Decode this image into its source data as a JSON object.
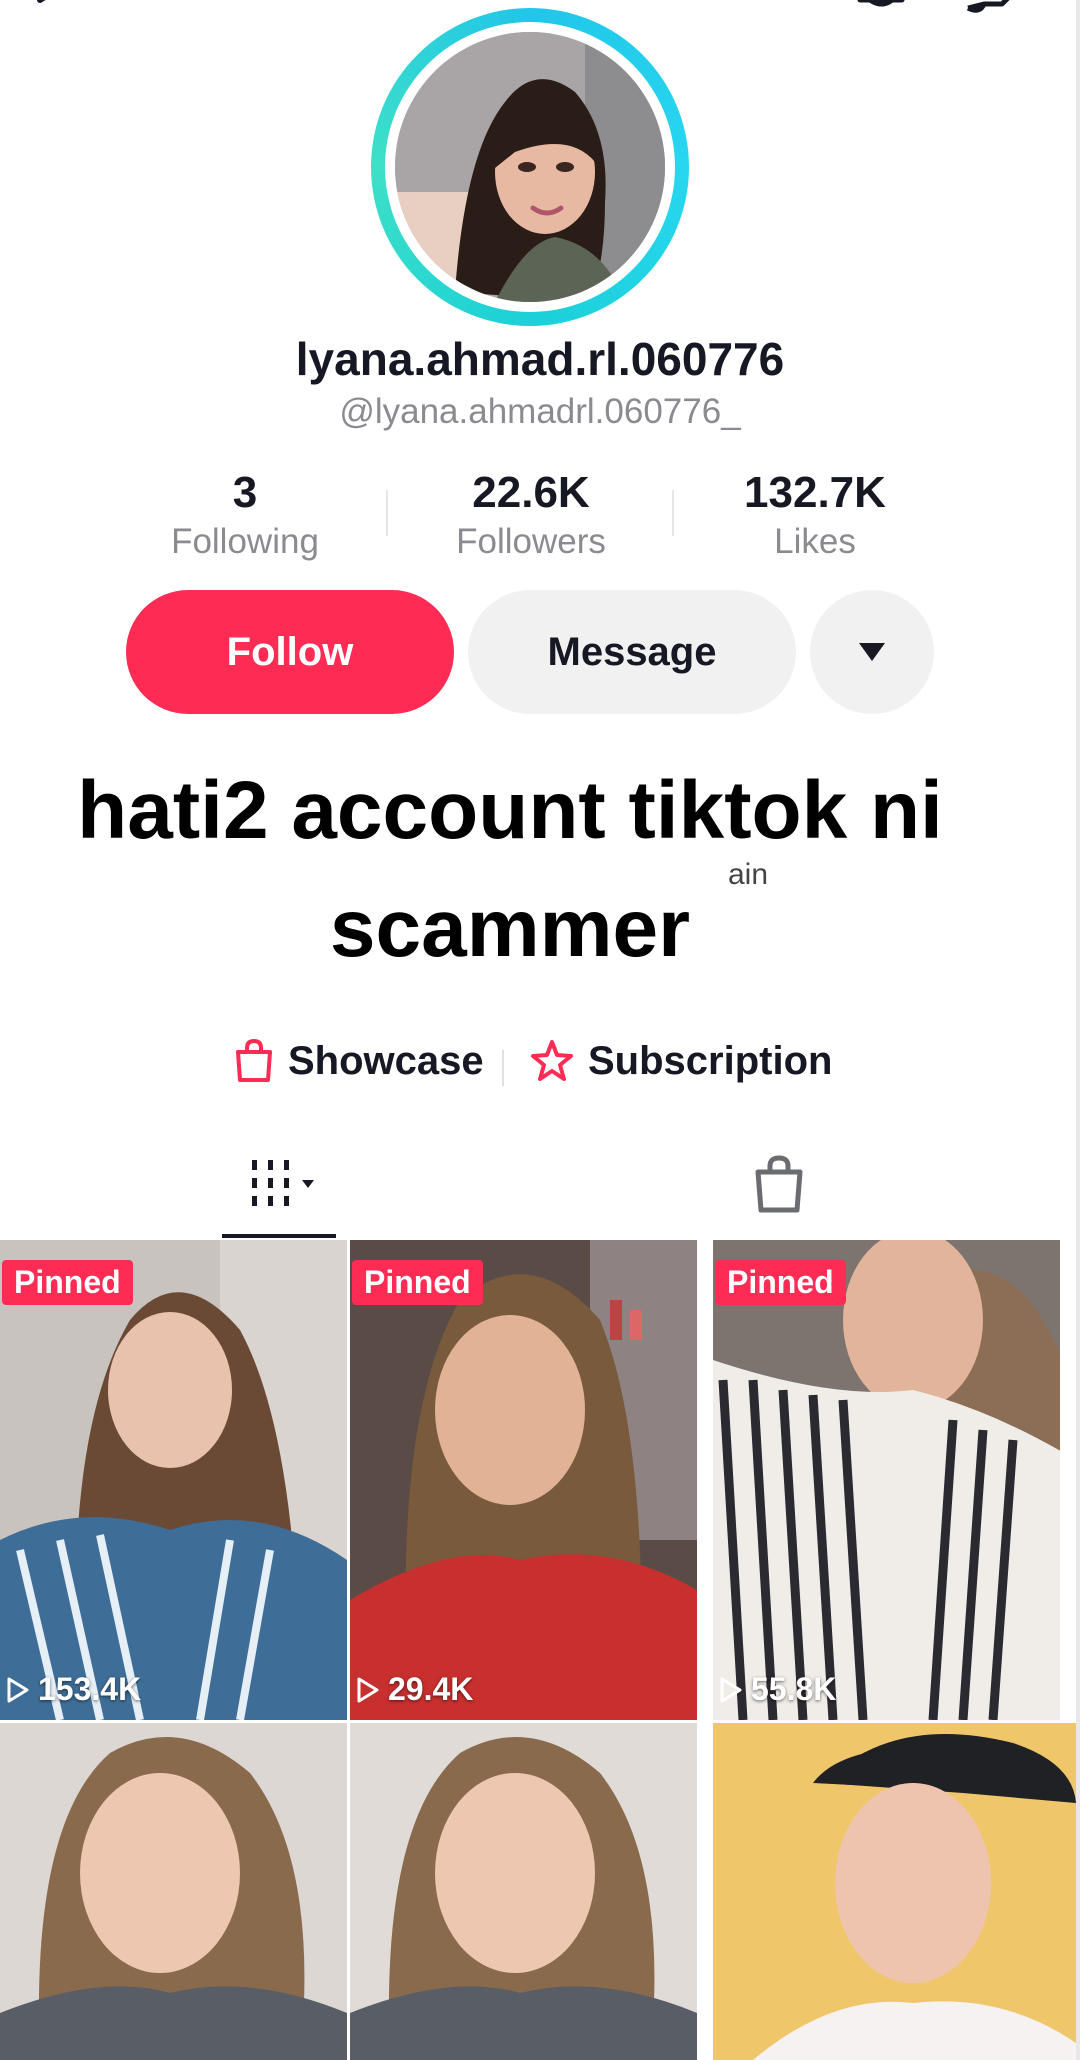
{
  "profile": {
    "display_name": "lyana.ahmad.rl.060776",
    "username": "@lyana.ahmadrl.060776_",
    "avatar_ring_color": "#21c6e8"
  },
  "stats": [
    {
      "value": "3",
      "label": "Following"
    },
    {
      "value": "22.6K",
      "label": "Followers"
    },
    {
      "value": "132.7K",
      "label": "Likes"
    }
  ],
  "actions": {
    "follow_label": "Follow",
    "message_label": "Message",
    "more_icon": "caret-down-icon",
    "follow_color": "#fe2c55"
  },
  "overlay_caption": {
    "line1": "hati2 account tiktok ni",
    "line2": "scammer",
    "partial_text": "ain"
  },
  "links": {
    "showcase_label": "Showcase",
    "subscription_label": "Subscription",
    "accent_color": "#fe2c55"
  },
  "tabs": [
    {
      "icon": "video-grid-icon",
      "active": true
    },
    {
      "icon": "shopping-bag-icon",
      "active": false
    }
  ],
  "videos": [
    {
      "badge": "Pinned",
      "views": "153.4K"
    },
    {
      "badge": "Pinned",
      "views": "29.4K"
    },
    {
      "badge": "Pinned",
      "views": "55.8K"
    },
    {
      "badge": "",
      "views": ""
    },
    {
      "badge": "",
      "views": ""
    },
    {
      "badge": "",
      "views": ""
    }
  ]
}
